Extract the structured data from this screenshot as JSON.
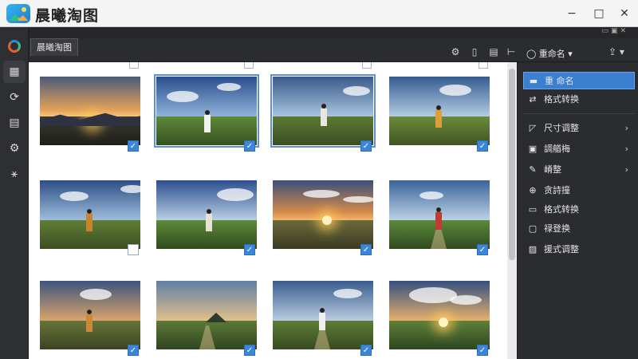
{
  "app": {
    "title": "晨曦淘图",
    "tab_label": "晨曦淘图",
    "window_controls": {
      "minimize": "−",
      "maximize": "□",
      "close": "✕"
    }
  },
  "rail": {
    "items": [
      {
        "name": "app-logo-icon",
        "glyph": ""
      },
      {
        "name": "grid-view-icon",
        "glyph": "▦"
      },
      {
        "name": "transform-icon",
        "glyph": "⟳"
      },
      {
        "name": "document-icon",
        "glyph": "▤"
      },
      {
        "name": "settings-gear-icon",
        "glyph": "⚙"
      },
      {
        "name": "adjust-icon",
        "glyph": "⚹"
      }
    ]
  },
  "toolbar": {
    "icons": [
      "⚙",
      "▯",
      "▤",
      "⊢"
    ],
    "rename_label": "◯  重命名 ▾",
    "share_glyph": "⇪ ▾"
  },
  "grid": {
    "photos": [
      {
        "label": "sunset over mountains",
        "checked": true
      },
      {
        "label": "child in field under cloudy sky",
        "checked": true
      },
      {
        "label": "child standing in grass",
        "checked": true
      },
      {
        "label": "child in yellow jacket",
        "checked": true
      },
      {
        "label": "child in orange jacket in field",
        "checked": false
      },
      {
        "label": "child facing horizon",
        "checked": true
      },
      {
        "label": "sunset over meadow",
        "checked": true
      },
      {
        "label": "girl in red on path",
        "checked": true
      },
      {
        "label": "child at dusk",
        "checked": true
      },
      {
        "label": "path to distant hill",
        "checked": true
      },
      {
        "label": "child in white on path",
        "checked": true
      },
      {
        "label": "sunset clouds over field",
        "checked": true
      }
    ]
  },
  "panel": {
    "items": [
      {
        "icon": "▬",
        "label": "重 命名",
        "active": true,
        "arrow": ""
      },
      {
        "icon": "⇄",
        "label": "格式转换",
        "active": false,
        "arrow": ""
      },
      {
        "icon": "◸",
        "label": "尺寸调整",
        "active": false,
        "arrow": "›"
      },
      {
        "icon": "▣",
        "label": "調艏梅",
        "active": false,
        "arrow": "›"
      },
      {
        "icon": "✎",
        "label": "嵴整",
        "active": false,
        "arrow": "›"
      },
      {
        "icon": "⊕",
        "label": "贪詩撞",
        "active": false,
        "arrow": ""
      },
      {
        "icon": "▭",
        "label": "格式转换",
        "active": false,
        "arrow": ""
      },
      {
        "icon": "▢",
        "label": "禄登换",
        "active": false,
        "arrow": ""
      },
      {
        "icon": "▨",
        "label": "援式调整",
        "active": false,
        "arrow": ""
      }
    ]
  },
  "colors": {
    "accent": "#3b7fd1",
    "checkbox": "#3d86d6",
    "panel_bg": "#2b2c30"
  }
}
